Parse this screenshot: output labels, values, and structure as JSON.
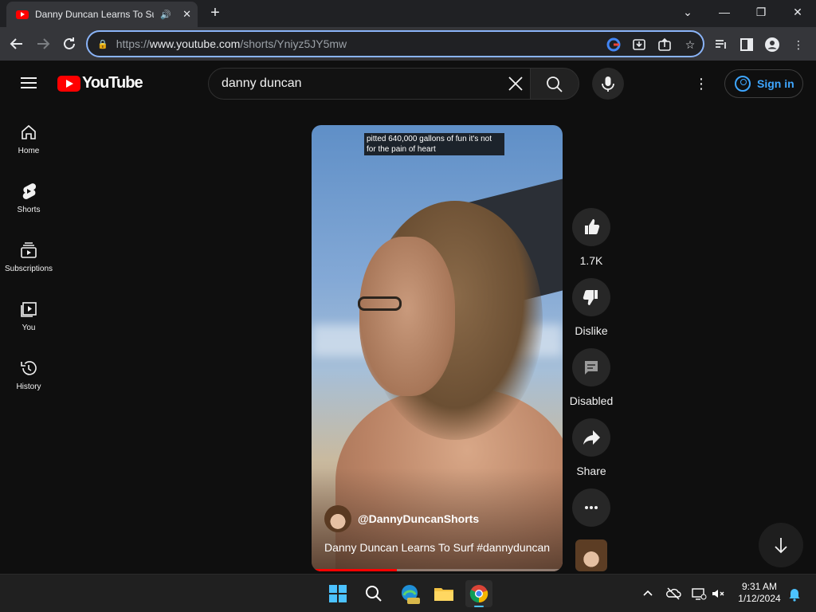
{
  "browser": {
    "tab_title": "Danny Duncan Learns To Surf",
    "url_prefix": "https://",
    "url_host": "www.youtube.com",
    "url_path": "/shorts/Yniyz5JY5mw",
    "window_controls": {
      "chevron": "⌄",
      "minimize": "—",
      "restore": "❐",
      "close": "✕"
    }
  },
  "header": {
    "logo_text": "YouTube",
    "search_value": "danny duncan",
    "signin_label": "Sign in"
  },
  "rail": {
    "items": [
      {
        "label": "Home",
        "icon": "home-icon"
      },
      {
        "label": "Shorts",
        "icon": "shorts-icon"
      },
      {
        "label": "Subscriptions",
        "icon": "subscriptions-icon"
      },
      {
        "label": "You",
        "icon": "you-icon"
      },
      {
        "label": "History",
        "icon": "history-icon"
      }
    ]
  },
  "video": {
    "caption": "pitted 640,000 gallons of fun it's not for the pain of heart",
    "channel_handle": "@DannyDuncanShorts",
    "title": "Danny Duncan Learns To Surf #dannyduncan",
    "progress": 0.34
  },
  "actions": {
    "like_label": "1.7K",
    "dislike_label": "Dislike",
    "comments_label": "Disabled",
    "share_label": "Share"
  },
  "taskbar": {
    "time": "9:31 AM",
    "date": "1/12/2024"
  },
  "colors": {
    "brand_red": "#ff0000",
    "accent_blue": "#3ea6ff",
    "omnibox_focus": "#8ab4f8"
  }
}
